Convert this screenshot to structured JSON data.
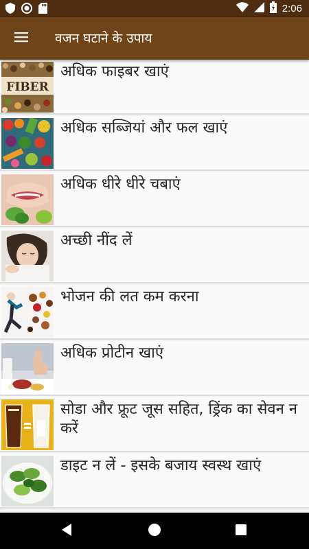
{
  "status_bar": {
    "time": "2:06",
    "left_icons": [
      "shield-icon",
      "record-icon",
      "sd-card-icon"
    ],
    "right_icons": [
      "wifi-icon",
      "signal-icon",
      "battery-icon"
    ]
  },
  "app_bar": {
    "menu_icon": "hamburger-menu-icon",
    "title": "वजन घटाने के उपाय"
  },
  "items": [
    {
      "label": "अधिक फाइबर खाएं",
      "thumb_text": "FIBER"
    },
    {
      "label": "अधिक सब्जियां और फल खाएं"
    },
    {
      "label": "अधिक धीरे धीरे चबाएं"
    },
    {
      "label": "अच्छी नींद लें"
    },
    {
      "label": "भोजन की लत कम करना"
    },
    {
      "label": "अधिक प्रोटीन खाएं"
    },
    {
      "label": "सोडा और फ्रूट जूस सहित, ड्रिंक का सेवन न करें"
    },
    {
      "label": "डाइट न लें - इसके बजाय स्वस्थ खाएं"
    }
  ],
  "nav_bar": {
    "buttons": [
      "back-icon",
      "home-icon",
      "recents-icon"
    ]
  },
  "colors": {
    "status_bar": "#4e2c0f",
    "app_bar": "#6d4518",
    "list_background": "#fafafa",
    "divider": "#dcdcdc",
    "text": "#262626"
  }
}
